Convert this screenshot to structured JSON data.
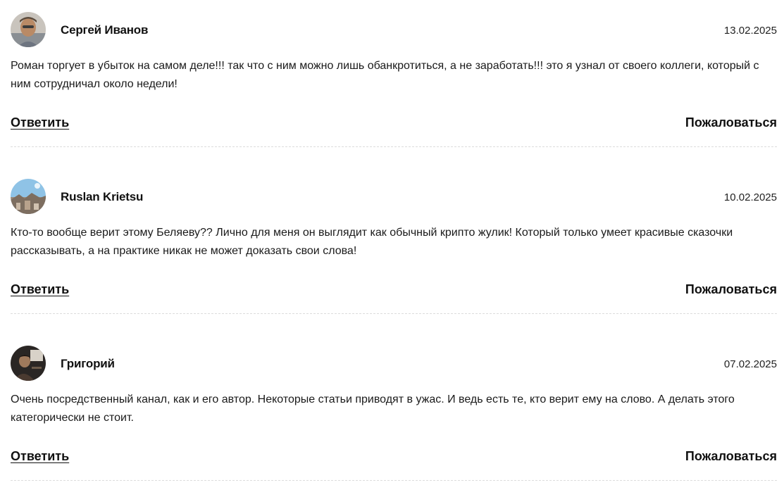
{
  "comments": [
    {
      "author": "Сергей Иванов",
      "date": "13.02.2025",
      "text": "Роман торгует в убыток на самом деле!!! так что с ним можно лишь обанкротиться, а не заработать!!! это я узнал от своего коллеги, который с ним сотрудничал около недели!",
      "reply_label": "Ответить",
      "report_label": "Пожаловаться"
    },
    {
      "author": "Ruslan Krietsu",
      "date": "10.02.2025",
      "text": "Кто-то вообще верит этому Беляеву?? Лично для меня он выглядит как обычный крипто жулик! Который только умеет красивые сказочки рассказывать, а на практике никак не может доказать свои слова!",
      "reply_label": "Ответить",
      "report_label": "Пожаловаться"
    },
    {
      "author": "Григорий",
      "date": "07.02.2025",
      "text": "Очень посредственный канал, как и его автор. Некоторые статьи приводят в ужас. И ведь есть те, кто верит ему на слово. А делать этого категорически не стоит.",
      "reply_label": "Ответить",
      "report_label": "Пожаловаться"
    }
  ]
}
